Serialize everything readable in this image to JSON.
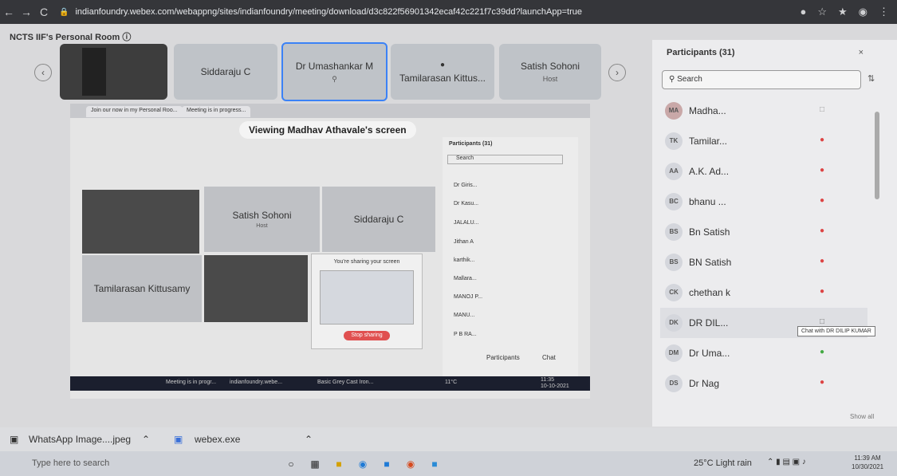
{
  "browser": {
    "url": "indianfoundry.webex.com/webappng/sites/indianfoundry/meeting/download/d3c822f56901342ecaf42c221f7c39dd?launchApp=true",
    "back": "←",
    "forward": "→",
    "reload": "C"
  },
  "room": {
    "title": "NCTS IIF's Personal Room ⓘ"
  },
  "top_tiles": [
    {
      "name": "Siddaraju C",
      "sub": ""
    },
    {
      "name": "Dr Umashankar M",
      "sub": ""
    },
    {
      "name": "Tamilarasan Kittus...",
      "sub": ""
    },
    {
      "name": "Satish Sohoni",
      "sub": "Host"
    }
  ],
  "shared_screen": {
    "viewing_label": "Viewing Madhav Athavale's screen",
    "tab1": "Join our now in my Personal Roo...",
    "tab2": "Meeting is in progress...",
    "inner_tile_satish": "Satish Sohoni",
    "inner_tile_satish_sub": "Host",
    "inner_tile_siddaraju": "Siddaraju C",
    "inner_tile_tamil": "Tamilarasan Kittusamy",
    "sharing_text": "You're sharing your screen",
    "stop_sharing": "Stop sharing",
    "inner_participants_title": "Participants (31)",
    "inner_search": "Search",
    "inner_rows": [
      "Dr Giris...",
      "Dr Kasu...",
      "JALALU...",
      "Jithan A",
      "karthik...",
      "Mallara...",
      "MANOJ P...",
      "MANU...",
      "P B RA..."
    ],
    "inner_participants_btn": "Participants",
    "inner_chat_btn": "Chat",
    "inner_taskbar_a": "Meeting is in progr...",
    "inner_taskbar_b": "indianfoundry.webe...",
    "inner_taskbar_c": "Basic Grey Cast Iron...",
    "inner_time": "11:35",
    "inner_date": "10-10-2021",
    "inner_temp": "11°C"
  },
  "participants": {
    "title": "Participants (31)",
    "search_placeholder": "Search",
    "rows": [
      {
        "initials": "MA",
        "name": "Madha..."
      },
      {
        "initials": "TK",
        "name": "Tamilar..."
      },
      {
        "initials": "AA",
        "name": "A.K. Ad..."
      },
      {
        "initials": "BC",
        "name": "bhanu ..."
      },
      {
        "initials": "BS",
        "name": "Bn Satish"
      },
      {
        "initials": "BS",
        "name": "BN Satish"
      },
      {
        "initials": "CK",
        "name": "chethan k"
      },
      {
        "initials": "DK",
        "name": "DR DIL..."
      },
      {
        "initials": "DM",
        "name": "Dr Uma..."
      },
      {
        "initials": "DS",
        "name": "Dr Nag"
      }
    ],
    "tooltip": "Chat with DR DILIP KUMAR",
    "show_all": "Show all"
  },
  "downloads": {
    "item1": "WhatsApp Image....jpeg",
    "item2": "webex.exe"
  },
  "taskbar": {
    "search_placeholder": "Type here to search",
    "weather": "25°C  Light rain",
    "time": "11:39 AM",
    "date": "10/30/2021"
  }
}
